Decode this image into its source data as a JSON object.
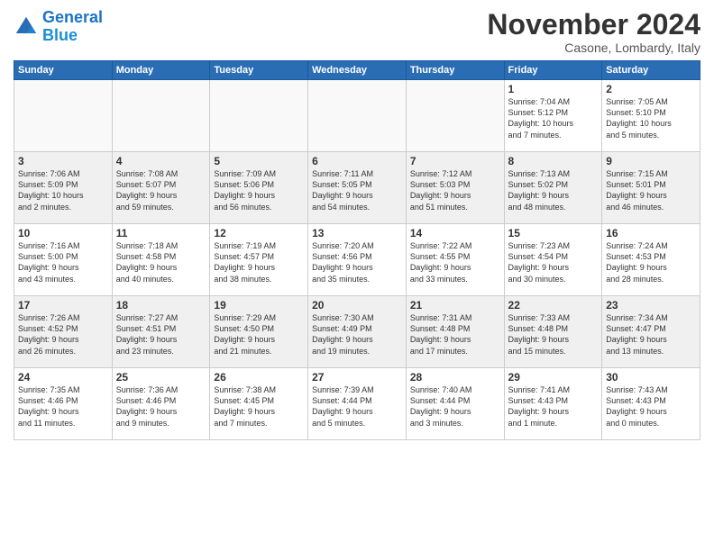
{
  "logo": {
    "line1": "General",
    "line2": "Blue"
  },
  "title": "November 2024",
  "subtitle": "Casone, Lombardy, Italy",
  "weekdays": [
    "Sunday",
    "Monday",
    "Tuesday",
    "Wednesday",
    "Thursday",
    "Friday",
    "Saturday"
  ],
  "weeks": [
    [
      {
        "day": "",
        "info": ""
      },
      {
        "day": "",
        "info": ""
      },
      {
        "day": "",
        "info": ""
      },
      {
        "day": "",
        "info": ""
      },
      {
        "day": "",
        "info": ""
      },
      {
        "day": "1",
        "info": "Sunrise: 7:04 AM\nSunset: 5:12 PM\nDaylight: 10 hours\nand 7 minutes."
      },
      {
        "day": "2",
        "info": "Sunrise: 7:05 AM\nSunset: 5:10 PM\nDaylight: 10 hours\nand 5 minutes."
      }
    ],
    [
      {
        "day": "3",
        "info": "Sunrise: 7:06 AM\nSunset: 5:09 PM\nDaylight: 10 hours\nand 2 minutes."
      },
      {
        "day": "4",
        "info": "Sunrise: 7:08 AM\nSunset: 5:07 PM\nDaylight: 9 hours\nand 59 minutes."
      },
      {
        "day": "5",
        "info": "Sunrise: 7:09 AM\nSunset: 5:06 PM\nDaylight: 9 hours\nand 56 minutes."
      },
      {
        "day": "6",
        "info": "Sunrise: 7:11 AM\nSunset: 5:05 PM\nDaylight: 9 hours\nand 54 minutes."
      },
      {
        "day": "7",
        "info": "Sunrise: 7:12 AM\nSunset: 5:03 PM\nDaylight: 9 hours\nand 51 minutes."
      },
      {
        "day": "8",
        "info": "Sunrise: 7:13 AM\nSunset: 5:02 PM\nDaylight: 9 hours\nand 48 minutes."
      },
      {
        "day": "9",
        "info": "Sunrise: 7:15 AM\nSunset: 5:01 PM\nDaylight: 9 hours\nand 46 minutes."
      }
    ],
    [
      {
        "day": "10",
        "info": "Sunrise: 7:16 AM\nSunset: 5:00 PM\nDaylight: 9 hours\nand 43 minutes."
      },
      {
        "day": "11",
        "info": "Sunrise: 7:18 AM\nSunset: 4:58 PM\nDaylight: 9 hours\nand 40 minutes."
      },
      {
        "day": "12",
        "info": "Sunrise: 7:19 AM\nSunset: 4:57 PM\nDaylight: 9 hours\nand 38 minutes."
      },
      {
        "day": "13",
        "info": "Sunrise: 7:20 AM\nSunset: 4:56 PM\nDaylight: 9 hours\nand 35 minutes."
      },
      {
        "day": "14",
        "info": "Sunrise: 7:22 AM\nSunset: 4:55 PM\nDaylight: 9 hours\nand 33 minutes."
      },
      {
        "day": "15",
        "info": "Sunrise: 7:23 AM\nSunset: 4:54 PM\nDaylight: 9 hours\nand 30 minutes."
      },
      {
        "day": "16",
        "info": "Sunrise: 7:24 AM\nSunset: 4:53 PM\nDaylight: 9 hours\nand 28 minutes."
      }
    ],
    [
      {
        "day": "17",
        "info": "Sunrise: 7:26 AM\nSunset: 4:52 PM\nDaylight: 9 hours\nand 26 minutes."
      },
      {
        "day": "18",
        "info": "Sunrise: 7:27 AM\nSunset: 4:51 PM\nDaylight: 9 hours\nand 23 minutes."
      },
      {
        "day": "19",
        "info": "Sunrise: 7:29 AM\nSunset: 4:50 PM\nDaylight: 9 hours\nand 21 minutes."
      },
      {
        "day": "20",
        "info": "Sunrise: 7:30 AM\nSunset: 4:49 PM\nDaylight: 9 hours\nand 19 minutes."
      },
      {
        "day": "21",
        "info": "Sunrise: 7:31 AM\nSunset: 4:48 PM\nDaylight: 9 hours\nand 17 minutes."
      },
      {
        "day": "22",
        "info": "Sunrise: 7:33 AM\nSunset: 4:48 PM\nDaylight: 9 hours\nand 15 minutes."
      },
      {
        "day": "23",
        "info": "Sunrise: 7:34 AM\nSunset: 4:47 PM\nDaylight: 9 hours\nand 13 minutes."
      }
    ],
    [
      {
        "day": "24",
        "info": "Sunrise: 7:35 AM\nSunset: 4:46 PM\nDaylight: 9 hours\nand 11 minutes."
      },
      {
        "day": "25",
        "info": "Sunrise: 7:36 AM\nSunset: 4:46 PM\nDaylight: 9 hours\nand 9 minutes."
      },
      {
        "day": "26",
        "info": "Sunrise: 7:38 AM\nSunset: 4:45 PM\nDaylight: 9 hours\nand 7 minutes."
      },
      {
        "day": "27",
        "info": "Sunrise: 7:39 AM\nSunset: 4:44 PM\nDaylight: 9 hours\nand 5 minutes."
      },
      {
        "day": "28",
        "info": "Sunrise: 7:40 AM\nSunset: 4:44 PM\nDaylight: 9 hours\nand 3 minutes."
      },
      {
        "day": "29",
        "info": "Sunrise: 7:41 AM\nSunset: 4:43 PM\nDaylight: 9 hours\nand 1 minute."
      },
      {
        "day": "30",
        "info": "Sunrise: 7:43 AM\nSunset: 4:43 PM\nDaylight: 9 hours\nand 0 minutes."
      }
    ]
  ]
}
